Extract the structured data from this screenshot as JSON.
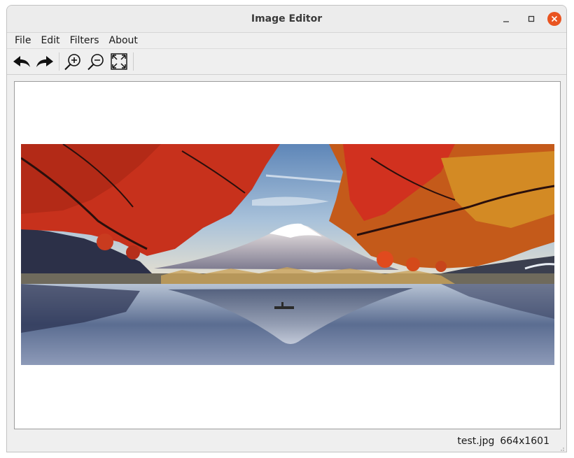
{
  "window": {
    "title": "Image Editor"
  },
  "menu": [
    {
      "id": "file",
      "label": "File"
    },
    {
      "id": "edit",
      "label": "Edit"
    },
    {
      "id": "filters",
      "label": "Filters"
    },
    {
      "id": "about",
      "label": "About"
    }
  ],
  "toolbar": {
    "icons": [
      "undo-icon",
      "redo-icon",
      "zoom-in-icon",
      "zoom-out-icon",
      "fit-to-window-icon"
    ]
  },
  "status": {
    "filename": "test.jpg",
    "dimensions": "664x1601"
  },
  "colors": {
    "accent": "#e95420",
    "chrome": "#efefef",
    "canvas": "#ffffff"
  }
}
